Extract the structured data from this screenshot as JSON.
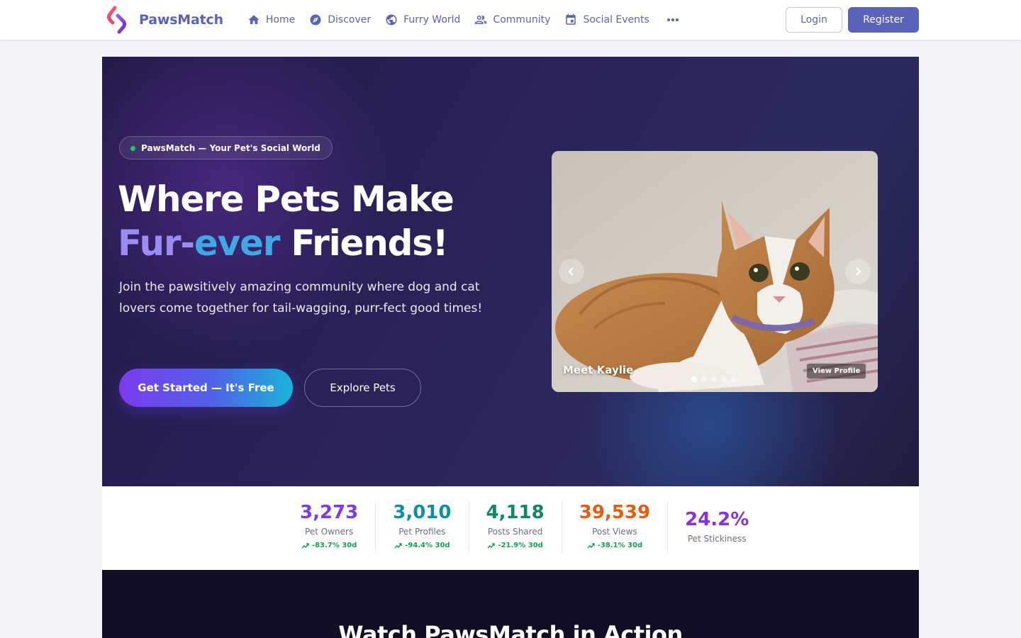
{
  "nav": {
    "brand": "PawsMatch",
    "links": [
      {
        "label": "Home",
        "icon": "home-icon"
      },
      {
        "label": "Discover",
        "icon": "compass-icon"
      },
      {
        "label": "Furry World",
        "icon": "globe-icon"
      },
      {
        "label": "Community",
        "icon": "people-icon"
      },
      {
        "label": "Social Events",
        "icon": "calendar-icon"
      }
    ],
    "more_icon": "more-dots-icon",
    "login": "Login",
    "register": "Register"
  },
  "hero": {
    "badge": "PawsMatch — Your Pet's Social World",
    "title_line1": "Where Pets Make",
    "title_grad_a": "Fur-",
    "title_grad_b": "ever",
    "title_rest": " Friends!",
    "subtitle": "Join the pawsitively amazing community where dog and cat lovers come together for tail-wagging, purr-fect good times!",
    "cta_primary": "Get Started — It's Free",
    "cta_secondary": "Explore Pets"
  },
  "carousel": {
    "caption": "Meet Kaylie",
    "profile_button": "View Profile",
    "slide_count": 5,
    "active_index": 0
  },
  "stats": [
    {
      "value": "3,273",
      "label": "Pet Owners",
      "trend": "-83.7% 30d",
      "color": "#7c3aed"
    },
    {
      "value": "3,010",
      "label": "Pet Profiles",
      "trend": "-94.4% 30d",
      "color": "#0e8fa3"
    },
    {
      "value": "4,118",
      "label": "Posts Shared",
      "trend": "-21.9% 30d",
      "color": "#0f8a5f"
    },
    {
      "value": "39,539",
      "label": "Post Views",
      "trend": "-38.1% 30d",
      "color": "#e35d12"
    },
    {
      "value": "24.2%",
      "label": "Pet Stickiness",
      "color": "#8a32d8"
    }
  ],
  "video_section": {
    "title": "Watch PawsMatch in Action"
  },
  "colors": {
    "brand": "#5a63b8",
    "trend_green": "#17a05a",
    "hero_bg": "#2a2259"
  }
}
